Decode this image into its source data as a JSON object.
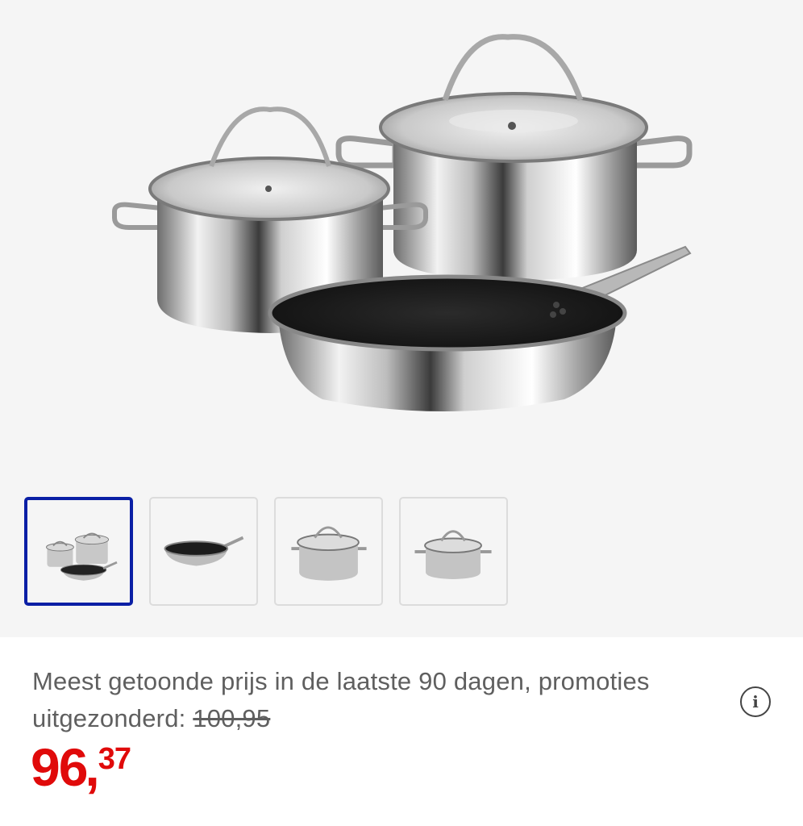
{
  "product": {
    "main_image_icon": "cookware-set-image",
    "thumbnails": [
      {
        "icon": "cookware-set-thumbnail",
        "selected": true
      },
      {
        "icon": "frying-pan-thumbnail",
        "selected": false
      },
      {
        "icon": "large-pot-thumbnail",
        "selected": false
      },
      {
        "icon": "small-pot-thumbnail",
        "selected": false
      }
    ]
  },
  "pricing": {
    "reference_text": "Meest getoonde prijs in de laatste 90 dagen, promoties uitgezonderd:",
    "old_price": "100,95",
    "price_whole": "96",
    "price_separator": ",",
    "price_cents": "37",
    "info_icon": "info-icon",
    "accent_color": "#e00a0a",
    "selected_border_color": "#0a1fa5"
  }
}
